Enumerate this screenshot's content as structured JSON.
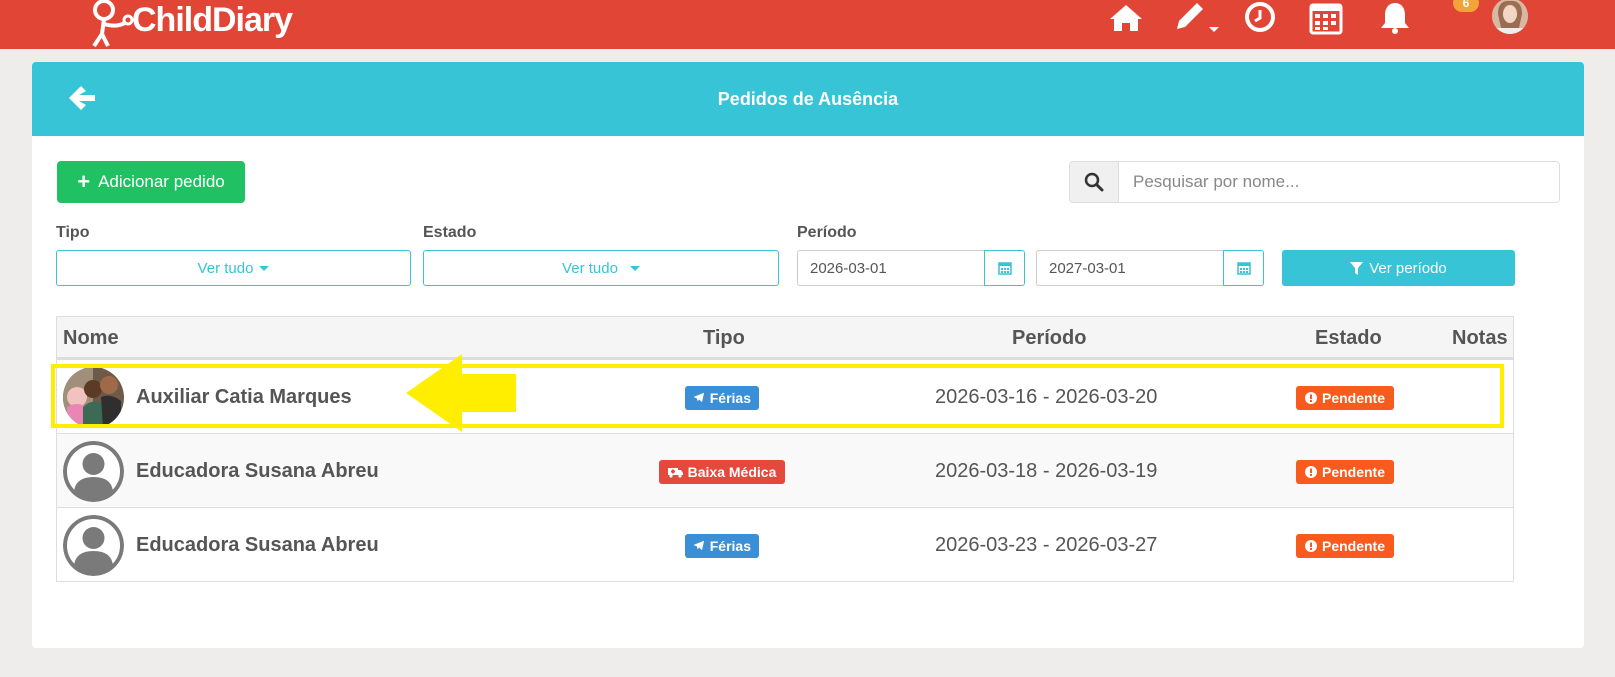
{
  "brand": {
    "name": "ChildDiary"
  },
  "topbar": {
    "icons": [
      "home-icon",
      "pencil-icon",
      "clock-icon",
      "calendar-icon",
      "bell-icon",
      "user-avatar"
    ],
    "notifications_count": "6",
    "colors": {
      "bar": "#e04536",
      "badge": "#f2a43a"
    }
  },
  "page": {
    "title": "Pedidos de Ausência",
    "add_button": "Adicionar pedido",
    "search_placeholder": "Pesquisar por nome..."
  },
  "filters": {
    "tipo": {
      "label": "Tipo",
      "value": "Ver tudo"
    },
    "estado": {
      "label": "Estado",
      "value": "Ver tudo"
    },
    "periodo": {
      "label": "Período",
      "start": "2026-03-01",
      "end": "2027-03-01"
    },
    "apply_button": "Ver período"
  },
  "table": {
    "headers": {
      "nome": "Nome",
      "tipo": "Tipo",
      "periodo": "Período",
      "estado": "Estado",
      "notas": "Notas"
    },
    "rows": [
      {
        "name": "Auxiliar Catia Marques",
        "type": "Férias",
        "type_icon": "plane-icon",
        "period": "2026-03-16 - 2026-03-20",
        "status": "Pendente",
        "notes": "",
        "avatar": "photo"
      },
      {
        "name": "Educadora Susana Abreu",
        "type": "Baixa Médica",
        "type_icon": "ambulance-icon",
        "period": "2026-03-18 - 2026-03-19",
        "status": "Pendente",
        "notes": "",
        "avatar": "default"
      },
      {
        "name": "Educadora Susana Abreu",
        "type": "Férias",
        "type_icon": "plane-icon",
        "period": "2026-03-23 - 2026-03-27",
        "status": "Pendente",
        "notes": "",
        "avatar": "default"
      }
    ]
  },
  "colors": {
    "header_teal": "#36c4d6",
    "green": "#1fc162",
    "ferias_blue": "#3a8fd6",
    "baixa_red": "#e5483c",
    "pendente_orange": "#f95b1f",
    "highlight_yellow": "#ffee00"
  }
}
